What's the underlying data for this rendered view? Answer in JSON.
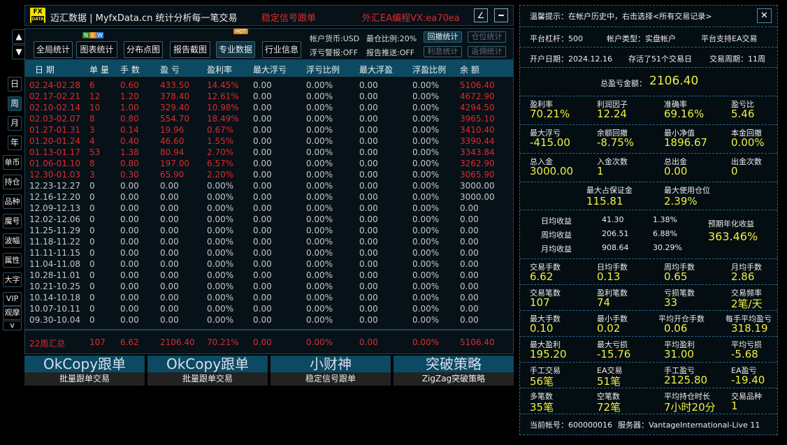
{
  "title": {
    "logo": "FX DATA",
    "app": "迈汇数据 | MyfxData.cn  统计分析每一笔交易",
    "signal": "稳定信号跟单",
    "promo": "外汇EA编程VX:ea70ea",
    "btn1": "∠",
    "btn2": "━"
  },
  "toolbar": {
    "buttons": [
      "全局统计",
      "图表统计",
      "分布点图",
      "报告截图",
      "专业数据",
      "行业信息"
    ],
    "new_badge": [
      "N",
      "E",
      "W"
    ],
    "hot_badge": "HOT",
    "currency": "帐户货币:USD",
    "exposure": "最仓比例:20%",
    "float_alert": "浮亏警报:OFF",
    "report_push": "报告推送:OFF",
    "side_buttons": [
      "回撤统计",
      "仓位统计",
      "利息统计",
      "返佣统计"
    ]
  },
  "nav": {
    "up": "▲",
    "down": "▼",
    "tabs": [
      "日",
      "周",
      "月",
      "年",
      "单币",
      "持仓",
      "品种",
      "魔号",
      "波幅",
      "属性",
      "大字",
      "VIP",
      "观摩",
      "v"
    ]
  },
  "table": {
    "headers": [
      "日 期",
      "单 量",
      "手 数",
      "盈 亏",
      "盈利率",
      "最大浮亏",
      "浮亏比例",
      "最大浮盈",
      "浮盈比例",
      "余 额"
    ],
    "rows": [
      [
        "02.24-02.28",
        "6",
        "0.60",
        "433.50",
        "14.45%",
        "0.00",
        "0.00%",
        "0.00",
        "0.00%",
        "5106.40"
      ],
      [
        "02.17-02.21",
        "12",
        "1.20",
        "378.40",
        "12.61%",
        "0.00",
        "0.00%",
        "0.00",
        "0.00%",
        "4672.90"
      ],
      [
        "02.10-02.14",
        "10",
        "1.00",
        "329.40",
        "10.98%",
        "0.00",
        "0.00%",
        "0.00",
        "0.00%",
        "4294.50"
      ],
      [
        "02.03-02.07",
        "8",
        "0.80",
        "554.70",
        "18.49%",
        "0.00",
        "0.00%",
        "0.00",
        "0.00%",
        "3965.10"
      ],
      [
        "01.27-01.31",
        "3",
        "0.14",
        "19.96",
        "0.67%",
        "0.00",
        "0.00%",
        "0.00",
        "0.00%",
        "3410.40"
      ],
      [
        "01.20-01.24",
        "4",
        "0.40",
        "46.60",
        "1.55%",
        "0.00",
        "0.00%",
        "0.00",
        "0.00%",
        "3390.44"
      ],
      [
        "01.13-01.17",
        "53",
        "1.38",
        "80.94",
        "2.70%",
        "0.00",
        "0.00%",
        "0.00",
        "0.00%",
        "3343.84"
      ],
      [
        "01.06-01.10",
        "8",
        "0.80",
        "197.00",
        "6.57%",
        "0.00",
        "0.00%",
        "0.00",
        "0.00%",
        "3262.90"
      ],
      [
        "12.30-01.03",
        "3",
        "0.30",
        "65.90",
        "2.20%",
        "0.00",
        "0.00%",
        "0.00",
        "0.00%",
        "3065.90"
      ],
      [
        "12.23-12.27",
        "0",
        "0.00",
        "0.00",
        "0.00%",
        "0.00",
        "0.00%",
        "0.00",
        "0.00%",
        "3000.00"
      ],
      [
        "12.16-12.20",
        "0",
        "0.00",
        "0.00",
        "0.00%",
        "0.00",
        "0.00%",
        "0.00",
        "0.00%",
        "3000.00"
      ],
      [
        "12.09-12.13",
        "0",
        "0.00",
        "0.00",
        "0.00%",
        "0.00",
        "0.00%",
        "0.00",
        "0.00%",
        "0.00"
      ],
      [
        "12.02-12.06",
        "0",
        "0.00",
        "0.00",
        "0.00%",
        "0.00",
        "0.00%",
        "0.00",
        "0.00%",
        "0.00"
      ],
      [
        "11.25-11.29",
        "0",
        "0.00",
        "0.00",
        "0.00%",
        "0.00",
        "0.00%",
        "0.00",
        "0.00%",
        "0.00"
      ],
      [
        "11.18-11.22",
        "0",
        "0.00",
        "0.00",
        "0.00%",
        "0.00",
        "0.00%",
        "0.00",
        "0.00%",
        "0.00"
      ],
      [
        "11.11-11.15",
        "0",
        "0.00",
        "0.00",
        "0.00%",
        "0.00",
        "0.00%",
        "0.00",
        "0.00%",
        "0.00"
      ],
      [
        "11.04-11.08",
        "0",
        "0.00",
        "0.00",
        "0.00%",
        "0.00",
        "0.00%",
        "0.00",
        "0.00%",
        "0.00"
      ],
      [
        "10.28-11.01",
        "0",
        "0.00",
        "0.00",
        "0.00%",
        "0.00",
        "0.00%",
        "0.00",
        "0.00%",
        "0.00"
      ],
      [
        "10.21-10.25",
        "0",
        "0.00",
        "0.00",
        "0.00%",
        "0.00",
        "0.00%",
        "0.00",
        "0.00%",
        "0.00"
      ],
      [
        "10.14-10.18",
        "0",
        "0.00",
        "0.00",
        "0.00%",
        "0.00",
        "0.00%",
        "0.00",
        "0.00%",
        "0.00"
      ],
      [
        "10.07-10.11",
        "0",
        "0.00",
        "0.00",
        "0.00%",
        "0.00",
        "0.00%",
        "0.00",
        "0.00%",
        "0.00"
      ],
      [
        "09.30-10.04",
        "0",
        "0.00",
        "0.00",
        "0.00%",
        "0.00",
        "0.00%",
        "0.00",
        "0.00%",
        "0.00"
      ]
    ],
    "highlight_rows": 9,
    "summary": [
      "22周汇总",
      "107",
      "6.62",
      "2106.40",
      "70.21%",
      "0.00",
      "0.00%",
      "0.00",
      "0.00%",
      "5106.40"
    ]
  },
  "promos": [
    {
      "title": "OkCopy跟单",
      "sub": "批量跟单交易"
    },
    {
      "title": "OkCopy跟单",
      "sub": "批量跟单交易"
    },
    {
      "title": "小财神",
      "sub": "稳定信号跟单"
    },
    {
      "title": "突破策略",
      "sub": "ZigZag突破策略"
    }
  ],
  "panel": {
    "tip": "温馨提示：在帐户历史中，右击选择<所有交易记录>",
    "close": "✕",
    "leverage": "平台杠杆：500",
    "acct_type": "帐户类型：实盘帐户",
    "ea_support": "平台支持EA交易",
    "open_date": "开户日期：2024.12.16",
    "alive": "存活了51个交易日",
    "period": "交易周期：11周",
    "total_label": "总盈亏金额：",
    "total_value": "2106.40",
    "grid1": [
      [
        "盈利率",
        "70.21%"
      ],
      [
        "利润因子",
        "12.24"
      ],
      [
        "准确率",
        "69.16%"
      ],
      [
        "盈亏比",
        "5.46"
      ],
      [
        "最大浮亏",
        "-415.00"
      ],
      [
        "余额回撤",
        "-8.75%"
      ],
      [
        "最小净值",
        "1896.67"
      ],
      [
        "本金回撤",
        "0.00%"
      ],
      [
        "总入金",
        "3000.00"
      ],
      [
        "入金次数",
        "1"
      ],
      [
        "总出金",
        "0.00"
      ],
      [
        "出金次数",
        "0"
      ]
    ],
    "margin": [
      [
        "最大占保证金",
        "115.81"
      ],
      [
        "最大使用仓位",
        "2.39%"
      ]
    ],
    "avg": [
      [
        "日均收益",
        "41.30",
        "1.38%"
      ],
      [
        "周均收益",
        "206.51",
        "6.88%"
      ],
      [
        "月均收益",
        "908.64",
        "30.29%"
      ]
    ],
    "annual_label": "预期年化收益",
    "annual_value": "363.46%",
    "grid2": [
      [
        "交易手数",
        "6.62"
      ],
      [
        "日均手数",
        "0.13"
      ],
      [
        "周均手数",
        "0.65"
      ],
      [
        "月均手数",
        "2.86"
      ],
      [
        "交易笔数",
        "107"
      ],
      [
        "盈利笔数",
        "74"
      ],
      [
        "亏损笔数",
        "33"
      ],
      [
        "交易频率",
        "2笔/天"
      ],
      [
        "最大手数",
        "0.10"
      ],
      [
        "最小手数",
        "0.02"
      ],
      [
        "平均开仓手数",
        "0.06"
      ],
      [
        "每手平均盈亏",
        "318.19"
      ],
      [
        "最大盈利",
        "195.20"
      ],
      [
        "最大亏损",
        "-15.76"
      ],
      [
        "平均盈利",
        "31.00"
      ],
      [
        "平均亏损",
        "-5.68"
      ],
      [
        "手工交易",
        "56笔"
      ],
      [
        "EA交易",
        "51笔"
      ],
      [
        "手工盈亏",
        "2125.80"
      ],
      [
        "EA盈亏",
        "-19.40"
      ],
      [
        "多笔数",
        "35笔"
      ],
      [
        "空笔数",
        "72笔"
      ],
      [
        "平均持仓时长",
        "7小时20分"
      ],
      [
        "交易品种",
        "1"
      ]
    ],
    "account": "当前帐号：600000016",
    "server": "服务器：VantageInternational-Live 11"
  },
  "colors": {
    "profit": "#e02a2a",
    "text": "#c8c8c8",
    "value": "#f0f040",
    "header": "#0b4a62"
  }
}
